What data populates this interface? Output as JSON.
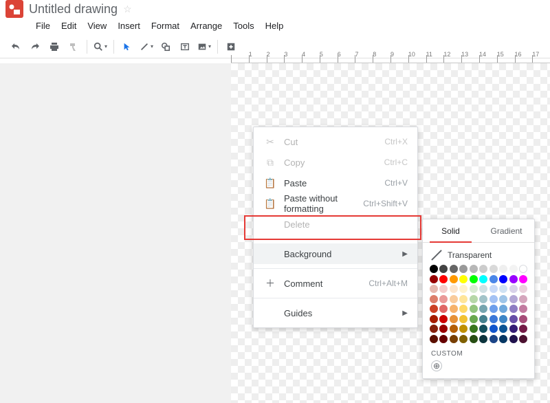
{
  "doc": {
    "title": "Untitled drawing"
  },
  "menubar": [
    "File",
    "Edit",
    "View",
    "Insert",
    "Format",
    "Arrange",
    "Tools",
    "Help"
  ],
  "ruler_ticks": [
    "",
    "1",
    "2",
    "3",
    "4",
    "5",
    "6",
    "7",
    "8",
    "9",
    "10",
    "11",
    "12",
    "13",
    "14",
    "15",
    "16",
    "17"
  ],
  "context_menu": {
    "items": [
      {
        "icon": "scissors",
        "label": "Cut",
        "shortcut": "Ctrl+X",
        "disabled": true
      },
      {
        "icon": "copy",
        "label": "Copy",
        "shortcut": "Ctrl+C",
        "disabled": true
      },
      {
        "icon": "clipboard",
        "label": "Paste",
        "shortcut": "Ctrl+V"
      },
      {
        "icon": "clipboard-plain",
        "label": "Paste without formatting",
        "shortcut": "Ctrl+Shift+V"
      },
      {
        "icon": "",
        "label": "Delete",
        "shortcut": "",
        "disabled": true
      }
    ],
    "background_label": "Background",
    "comment": {
      "label": "Comment",
      "shortcut": "Ctrl+Alt+M"
    },
    "guides_label": "Guides"
  },
  "color_panel": {
    "tabs": {
      "solid": "Solid",
      "gradient": "Gradient"
    },
    "transparent_label": "Transparent",
    "custom_label": "CUSTOM",
    "colors": [
      [
        "#000000",
        "#434343",
        "#666666",
        "#999999",
        "#b7b7b7",
        "#cccccc",
        "#d9d9d9",
        "#efefef",
        "#f3f3f3",
        "#ffffff"
      ],
      [
        "#980000",
        "#ff0000",
        "#ff9900",
        "#ffff00",
        "#00ff00",
        "#00ffff",
        "#4a86e8",
        "#0000ff",
        "#9900ff",
        "#ff00ff"
      ],
      [
        "#e6b8af",
        "#f4cccc",
        "#fce5cd",
        "#fff2cc",
        "#d9ead3",
        "#d0e0e3",
        "#c9daf8",
        "#cfe2f3",
        "#d9d2e9",
        "#ead1dc"
      ],
      [
        "#dd7e6b",
        "#ea9999",
        "#f9cb9c",
        "#ffe599",
        "#b6d7a8",
        "#a2c4c9",
        "#a4c2f4",
        "#9fc5e8",
        "#b4a7d6",
        "#d5a6bd"
      ],
      [
        "#cc4125",
        "#e06666",
        "#f6b26b",
        "#ffd966",
        "#93c47d",
        "#76a5af",
        "#6d9eeb",
        "#6fa8dc",
        "#8e7cc3",
        "#c27ba0"
      ],
      [
        "#a61c00",
        "#cc0000",
        "#e69138",
        "#f1c232",
        "#6aa84f",
        "#45818e",
        "#3c78d8",
        "#3d85c6",
        "#674ea7",
        "#a64d79"
      ],
      [
        "#85200c",
        "#990000",
        "#b45f06",
        "#bf9000",
        "#38761d",
        "#134f5c",
        "#1155cc",
        "#0b5394",
        "#351c75",
        "#741b47"
      ],
      [
        "#5b0f00",
        "#660000",
        "#783f04",
        "#7f6000",
        "#274e13",
        "#0c343d",
        "#1c4587",
        "#073763",
        "#20124d",
        "#4c1130"
      ]
    ]
  }
}
